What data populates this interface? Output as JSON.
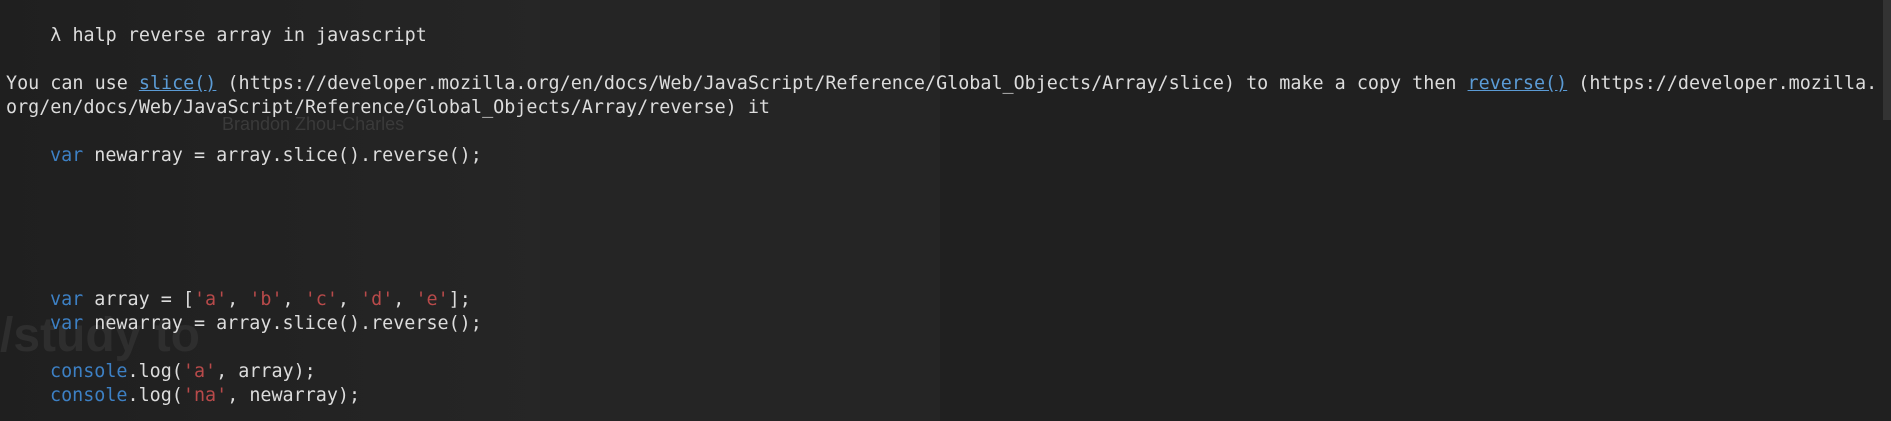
{
  "prompt": {
    "symbol": "λ",
    "command": "halp reverse array in javascript"
  },
  "answer": {
    "pre": "You can use ",
    "link1": "slice()",
    "mid1": " (https://developer.mozilla.org/en/docs/Web/JavaScript/Reference/Global_Objects/Array/slice) to make a copy then ",
    "link2": "reverse()",
    "mid2": " (https://developer.mozilla.",
    "line2": "org/en/docs/Web/JavaScript/Reference/Global_Objects/Array/reverse) it"
  },
  "code1": {
    "kw": "var",
    "rest": " newarray = array.slice().reverse();"
  },
  "code2": {
    "l1_kw": "var",
    "l1_a": " array = [",
    "s_a": "'a'",
    "s_b": "'b'",
    "s_c": "'c'",
    "s_d": "'d'",
    "s_e": "'e'",
    "comma": ", ",
    "l1_end": "];",
    "l2_kw": "var",
    "l2_rest": " newarray = array.slice().reverse();",
    "l3_kw": "console",
    "l3_a": ".log(",
    "l3_str": "'a'",
    "l3_end": ", array);",
    "l4_kw": "console",
    "l4_a": ".log(",
    "l4_str": "'na'",
    "l4_end": ", newarray);"
  },
  "background_ghost": {
    "name": "Brandon Zhou-Charles",
    "study": "/study to"
  }
}
